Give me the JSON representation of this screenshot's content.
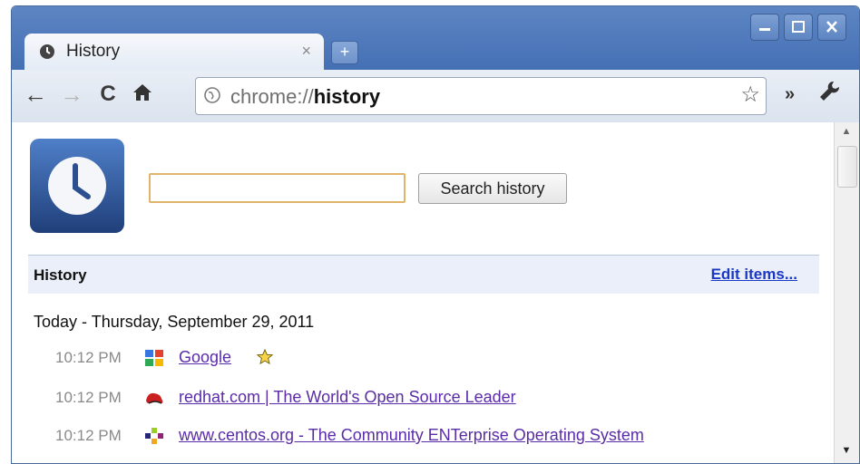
{
  "window": {
    "tab_title": "History",
    "tab_close": "×",
    "new_tab": "+",
    "controls": [
      "minimize",
      "maximize",
      "close"
    ]
  },
  "toolbar": {
    "back": "←",
    "forward": "→",
    "reload": "C",
    "home": "🏠",
    "url_scheme": "chrome://",
    "url_host": "history",
    "star": "☆",
    "more": "»",
    "wrench": "🔧"
  },
  "search": {
    "value": "",
    "button_label": "Search history"
  },
  "history_header": {
    "title": "History",
    "edit_label": "Edit items..."
  },
  "day_label": "Today - Thursday, September 29, 2011",
  "entries": [
    {
      "time": "10:12 PM",
      "title": "Google",
      "icon": "google-favicon",
      "starred": true
    },
    {
      "time": "10:12 PM",
      "title": "redhat.com | The World's Open Source Leader",
      "icon": "redhat-favicon",
      "starred": false
    },
    {
      "time": "10:12 PM",
      "title": "www.centos.org - The Community ENTerprise Operating System",
      "icon": "centos-favicon",
      "starred": false
    }
  ],
  "colors": {
    "titlebar": "#4f78b9",
    "link_visited": "#5a2ca8",
    "edit_link": "#1a39c4",
    "header_bg": "#ebeff9",
    "search_focus": "#e0b56b"
  }
}
